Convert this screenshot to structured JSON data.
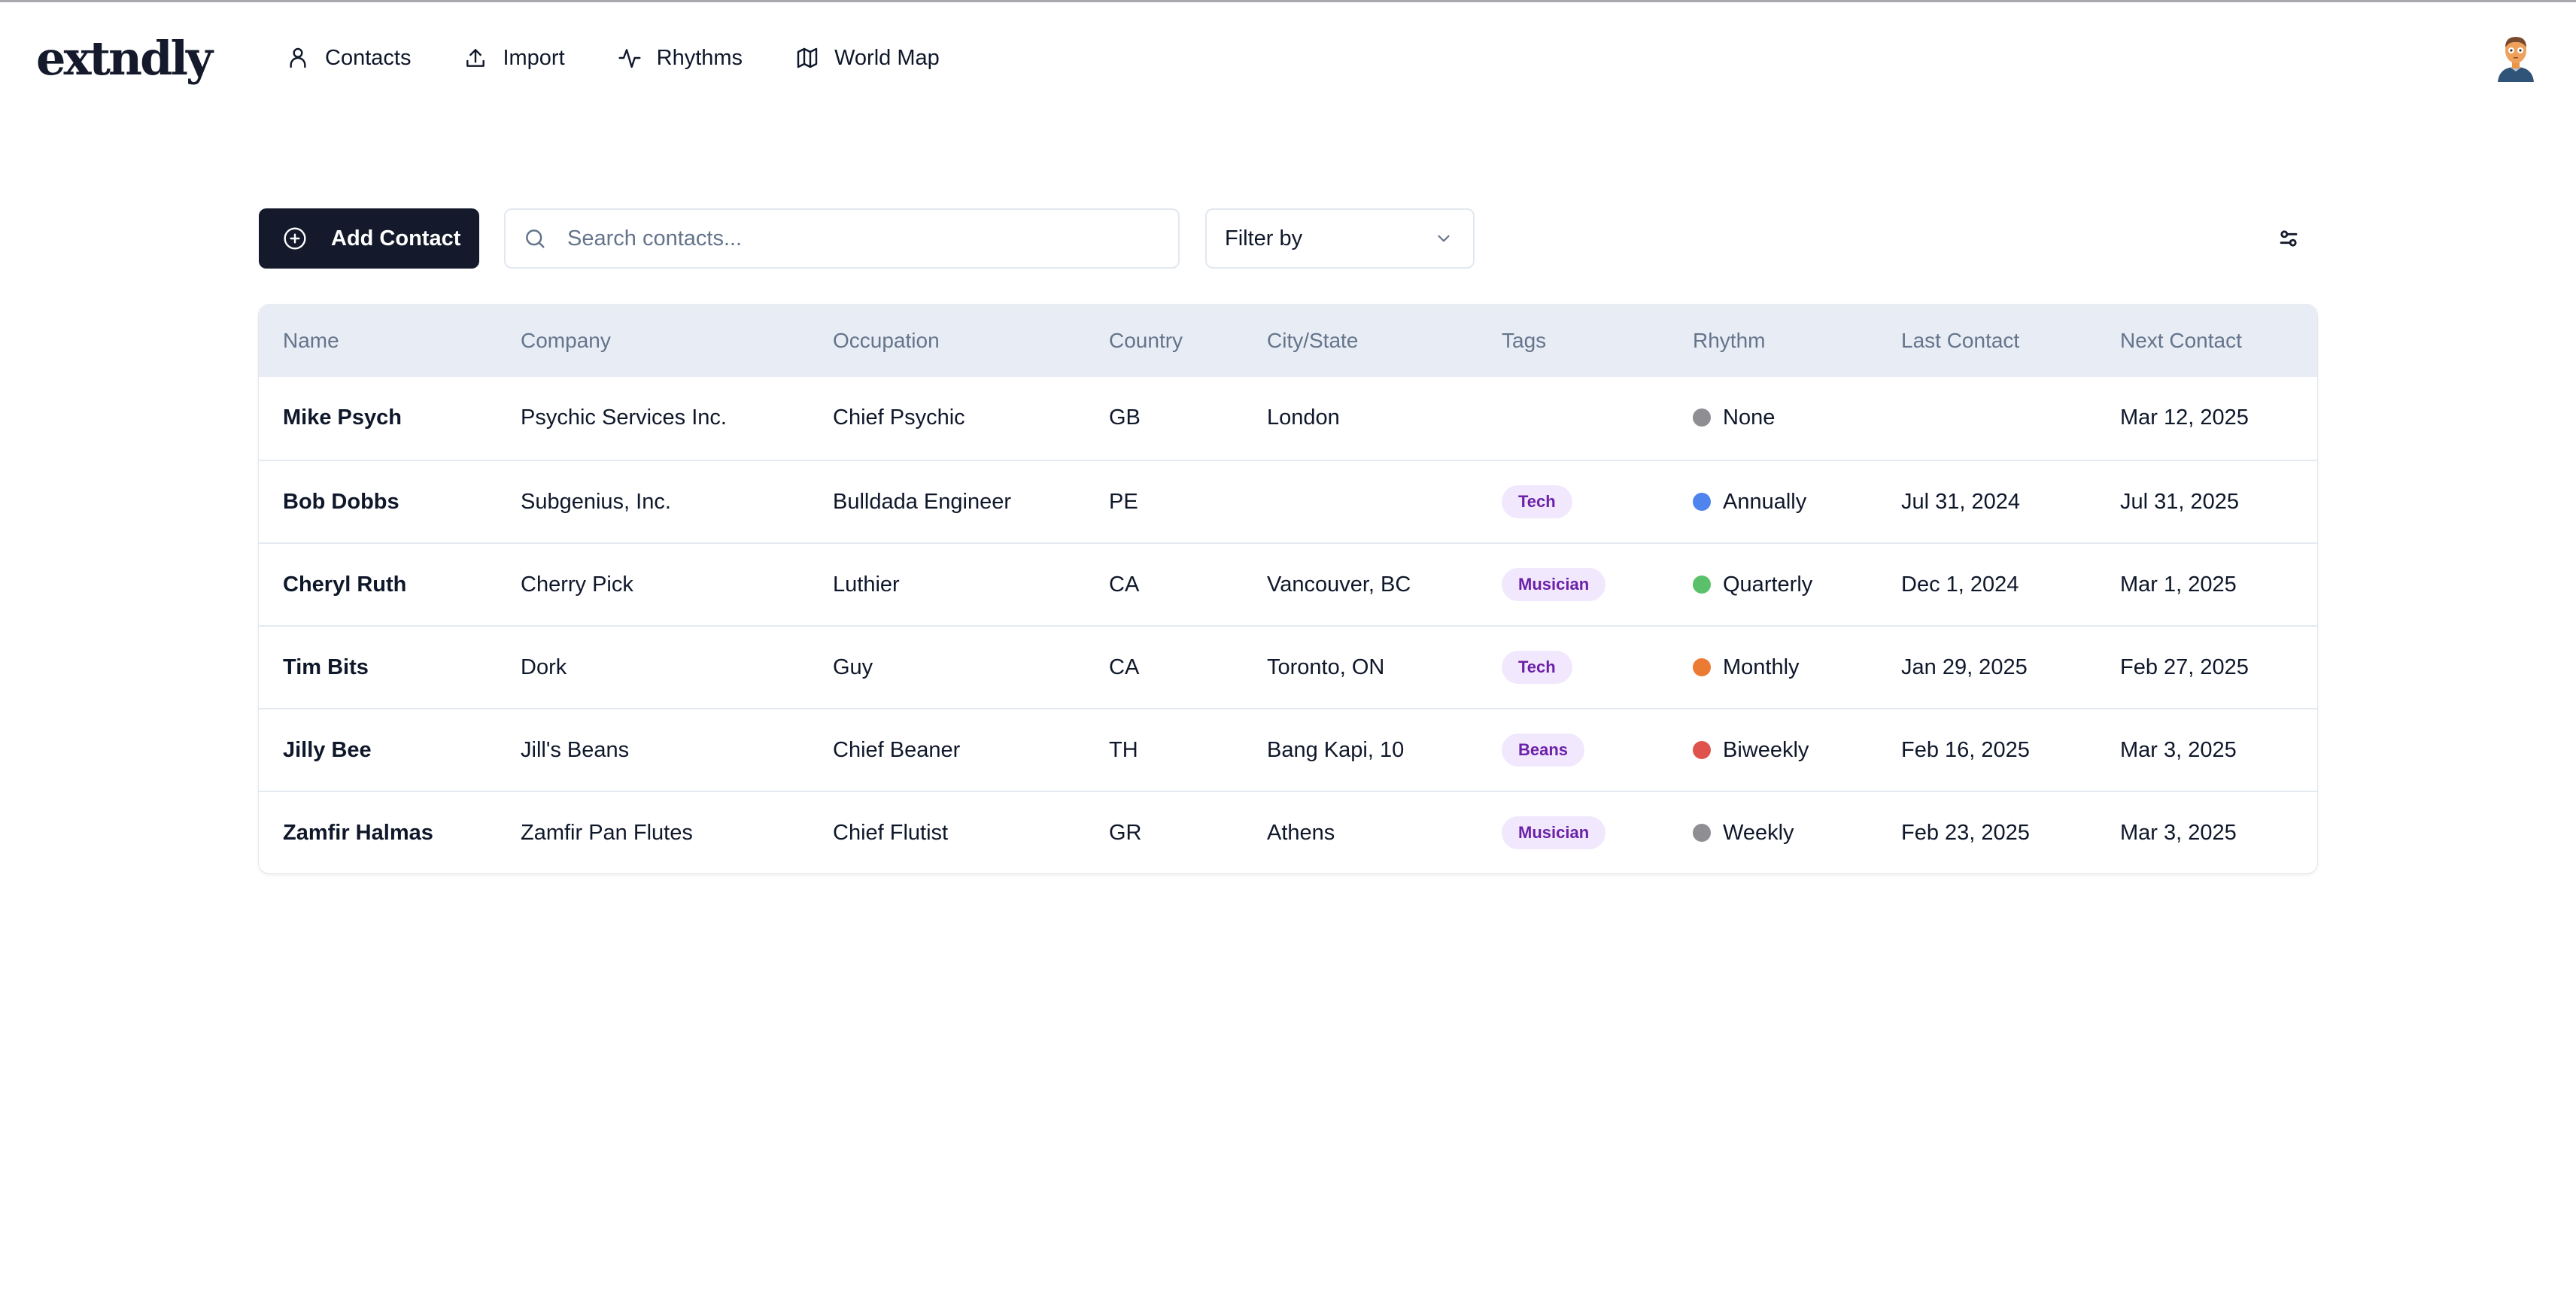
{
  "app": {
    "logo": "extndly",
    "nav": [
      {
        "label": "Contacts",
        "icon": "user-icon"
      },
      {
        "label": "Import",
        "icon": "upload-icon"
      },
      {
        "label": "Rhythms",
        "icon": "activity-icon"
      },
      {
        "label": "World Map",
        "icon": "map-icon"
      }
    ],
    "avatar_icon": "user-avatar"
  },
  "toolbar": {
    "add_label": "Add Contact",
    "search_placeholder": "Search contacts...",
    "search_value": "",
    "filter_label": "Filter by"
  },
  "colors": {
    "primary": "#141a2b",
    "header_bg": "#e8edf5",
    "tag_bg": "#f1e8fd",
    "tag_text": "#6b21a8",
    "rhythm": {
      "None": "#8e8e93",
      "Annually": "#4f83ee",
      "Quarterly": "#5bc06a",
      "Monthly": "#eb7a33",
      "Biweekly": "#e0534d",
      "Weekly": "#8e8e93"
    }
  },
  "table": {
    "columns": [
      "Name",
      "Company",
      "Occupation",
      "Country",
      "City/State",
      "Tags",
      "Rhythm",
      "Last Contact",
      "Next Contact"
    ],
    "rows": [
      {
        "name": "Mike Psych",
        "company": "Psychic Services Inc.",
        "occupation": "Chief Psychic",
        "country": "GB",
        "city": "London",
        "tag": "",
        "rhythm": "None",
        "rhythm_color": "#8e8e93",
        "last": "",
        "next": "Mar 12, 2025"
      },
      {
        "name": "Bob Dobbs",
        "company": "Subgenius, Inc.",
        "occupation": "Bulldada Engineer",
        "country": "PE",
        "city": "",
        "tag": "Tech",
        "rhythm": "Annually",
        "rhythm_color": "#4f83ee",
        "last": "Jul 31, 2024",
        "next": "Jul 31, 2025"
      },
      {
        "name": "Cheryl Ruth",
        "company": "Cherry Pick",
        "occupation": "Luthier",
        "country": "CA",
        "city": "Vancouver, BC",
        "tag": "Musician",
        "rhythm": "Quarterly",
        "rhythm_color": "#5bc06a",
        "last": "Dec 1, 2024",
        "next": "Mar 1, 2025"
      },
      {
        "name": "Tim Bits",
        "company": "Dork",
        "occupation": "Guy",
        "country": "CA",
        "city": "Toronto, ON",
        "tag": "Tech",
        "rhythm": "Monthly",
        "rhythm_color": "#eb7a33",
        "last": "Jan 29, 2025",
        "next": "Feb 27, 2025"
      },
      {
        "name": "Jilly Bee",
        "company": "Jill's Beans",
        "occupation": "Chief Beaner",
        "country": "TH",
        "city": "Bang Kapi, 10",
        "tag": "Beans",
        "rhythm": "Biweekly",
        "rhythm_color": "#e0534d",
        "last": "Feb 16, 2025",
        "next": "Mar 3, 2025"
      },
      {
        "name": "Zamfir Halmas",
        "company": "Zamfir Pan Flutes",
        "occupation": "Chief Flutist",
        "country": "GR",
        "city": "Athens",
        "tag": "Musician",
        "rhythm": "Weekly",
        "rhythm_color": "#8e8e93",
        "last": "Feb 23, 2025",
        "next": "Mar 3, 2025"
      }
    ]
  }
}
